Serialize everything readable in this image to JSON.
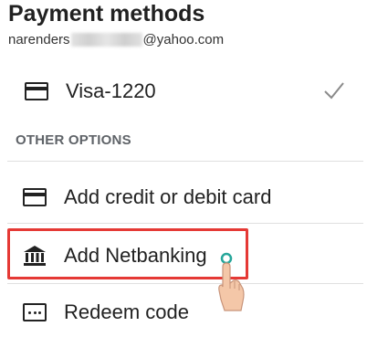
{
  "header": {
    "title": "Payment methods",
    "email_prefix": "narenders",
    "email_suffix": "@yahoo.com"
  },
  "saved_methods": [
    {
      "label": "Visa-1220",
      "icon": "credit-card-icon",
      "selected": true,
      "selected_icon": "checkmark-icon"
    }
  ],
  "other_options": {
    "header": "OTHER OPTIONS",
    "items": [
      {
        "label": "Add credit or debit card",
        "icon": "credit-card-icon"
      },
      {
        "label": "Add Netbanking",
        "icon": "bank-icon",
        "highlighted": true
      },
      {
        "label": "Redeem code",
        "icon": "redeem-code-icon"
      }
    ]
  },
  "colors": {
    "highlight": "#e53935",
    "touch_indicator": "#26a69a",
    "hand": "#f4c7a8"
  }
}
